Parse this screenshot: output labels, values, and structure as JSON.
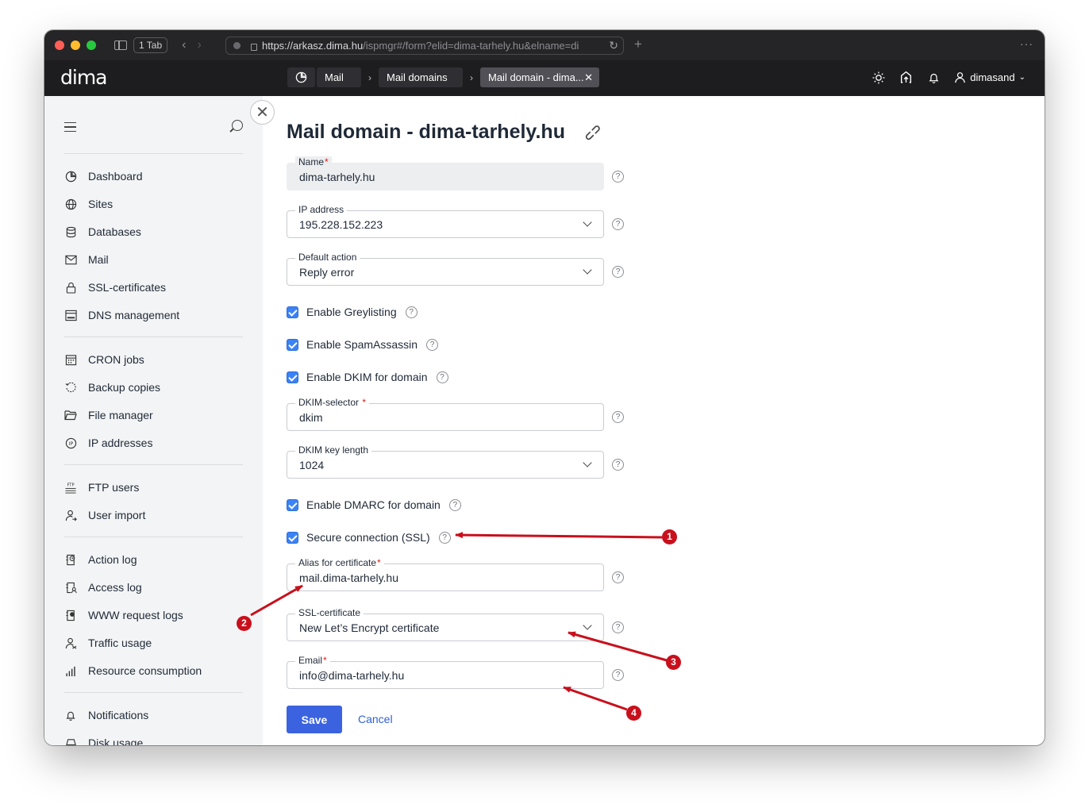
{
  "browser": {
    "tab_count": "1 Tab",
    "url_host": "https://arkasz.dima.hu",
    "url_path": "/ispmgr#/form?elid=dima-tarhely.hu&elname=di"
  },
  "header": {
    "logo": "dima",
    "breadcrumbs": [
      "Mail",
      "Mail domains",
      "Mail domain - dima..."
    ],
    "username": "dimasand"
  },
  "sidebar": {
    "groups": [
      [
        "Dashboard",
        "Sites",
        "Databases",
        "Mail",
        "SSL-certificates",
        "DNS management"
      ],
      [
        "CRON jobs",
        "Backup copies",
        "File manager",
        "IP addresses"
      ],
      [
        "FTP users",
        "User import"
      ],
      [
        "Action log",
        "Access log",
        "WWW request logs",
        "Traffic usage",
        "Resource consumption"
      ],
      [
        "Notifications",
        "Disk usage"
      ]
    ]
  },
  "form": {
    "title": "Mail domain - dima-tarhely.hu",
    "name_label": "Name",
    "name_value": "dima-tarhely.hu",
    "ip_label": "IP address",
    "ip_value": "195.228.152.223",
    "action_label": "Default action",
    "action_value": "Reply error",
    "greylisting_label": "Enable Greylisting",
    "spamassassin_label": "Enable SpamAssassin",
    "dkim_label": "Enable DKIM for domain",
    "dkim_selector_label": "DKIM-selector",
    "dkim_selector_value": "dkim",
    "dkim_length_label": "DKIM key length",
    "dkim_length_value": "1024",
    "dmarc_label": "Enable DMARC for domain",
    "ssl_label": "Secure connection (SSL)",
    "alias_label": "Alias for certificate",
    "alias_value": "mail.dima-tarhely.hu",
    "cert_label": "SSL-certificate",
    "cert_value": "New Let’s Encrypt certificate",
    "email_label": "Email",
    "email_value": "info@dima-tarhely.hu",
    "save_label": "Save",
    "cancel_label": "Cancel",
    "help_glyph": "?"
  },
  "annotations": [
    "1",
    "2",
    "3",
    "4"
  ],
  "colors": {
    "accent": "#3b63e0",
    "checkbox": "#3b82f6",
    "annotation": "#c8101c",
    "header_bg": "#1d1d1f",
    "sidebar_bg": "#f3f4f5"
  }
}
